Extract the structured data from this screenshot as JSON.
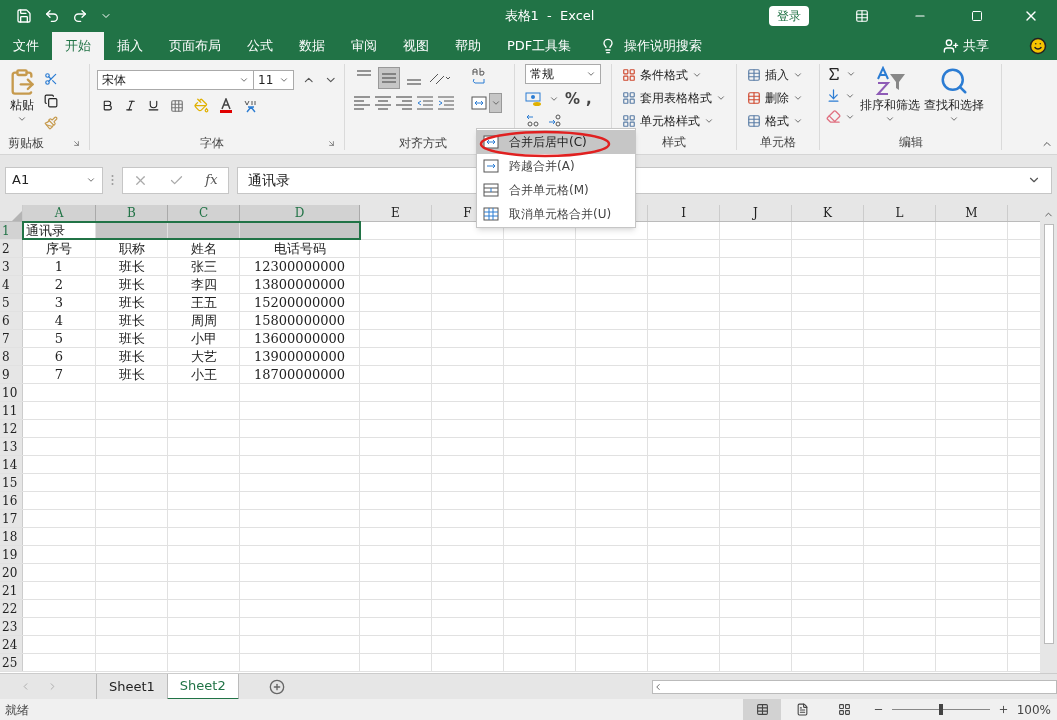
{
  "title_bar": {
    "title": "表格1  -  Excel",
    "login": "登录"
  },
  "menu_tabs": [
    {
      "label": "文件",
      "selected": false
    },
    {
      "label": "开始",
      "selected": true
    },
    {
      "label": "插入",
      "selected": false
    },
    {
      "label": "页面布局",
      "selected": false
    },
    {
      "label": "公式",
      "selected": false
    },
    {
      "label": "数据",
      "selected": false
    },
    {
      "label": "审阅",
      "selected": false
    },
    {
      "label": "视图",
      "selected": false
    },
    {
      "label": "帮助",
      "selected": false
    },
    {
      "label": "PDF工具集",
      "selected": false
    }
  ],
  "tell_me": "操作说明搜索",
  "share": "共享",
  "ribbon": {
    "clipboard": {
      "paste": "粘贴",
      "label": "剪贴板"
    },
    "font": {
      "name": "宋体",
      "size": "11",
      "label": "字体"
    },
    "alignment": {
      "vertical": [
        {
          "on": false
        },
        {
          "on": true
        },
        {
          "on": false
        }
      ],
      "label": "对齐方式"
    },
    "number": {
      "format": "常规",
      "percent": "%",
      "comma": ","
    },
    "styles": {
      "items": [
        "条件格式",
        "套用表格格式",
        "单元格样式"
      ],
      "label": "样式"
    },
    "cells": {
      "items": [
        "插入",
        "删除",
        "格式"
      ],
      "label": "单元格"
    },
    "editing": {
      "sort": "排序和筛选",
      "find": "查找和选择",
      "label": "编辑"
    }
  },
  "merge_menu": [
    {
      "label": "合并后居中(C)",
      "selected": true
    },
    {
      "label": "跨越合并(A)",
      "selected": false
    },
    {
      "label": "合并单元格(M)",
      "selected": false
    },
    {
      "label": "取消单元格合并(U)",
      "selected": false
    }
  ],
  "formula_bar": {
    "name_box": "A1",
    "function_label": "fx",
    "value": "通讯录"
  },
  "sheet": {
    "columns": [
      {
        "label": "A",
        "selected": true
      },
      {
        "label": "B",
        "selected": true
      },
      {
        "label": "C",
        "selected": true
      },
      {
        "label": "D",
        "selected": true
      },
      {
        "label": "E",
        "selected": false
      },
      {
        "label": "F",
        "selected": false
      },
      {},
      {},
      {
        "label": "I",
        "selected": false
      },
      {
        "label": "J",
        "selected": false
      },
      {
        "label": "K",
        "selected": false
      },
      {
        "label": "L",
        "selected": false
      },
      {
        "label": "M",
        "selected": false
      }
    ],
    "rows": [
      {
        "header": "1",
        "selected": true,
        "cells": [
          "通讯录"
        ]
      },
      {
        "header": "2",
        "selected": false,
        "cells": [
          "序号",
          "职称",
          "姓名",
          "电话号码"
        ]
      },
      {
        "header": "3",
        "selected": false,
        "cells": [
          "1",
          "班长",
          "张三",
          "12300000000"
        ]
      },
      {
        "header": "4",
        "selected": false,
        "cells": [
          "2",
          "班长",
          "李四",
          "13800000000"
        ]
      },
      {
        "header": "5",
        "selected": false,
        "cells": [
          "3",
          "班长",
          "王五",
          "15200000000"
        ]
      },
      {
        "header": "6",
        "selected": false,
        "cells": [
          "4",
          "班长",
          "周周",
          "15800000000"
        ]
      },
      {
        "header": "7",
        "selected": false,
        "cells": [
          "5",
          "班长",
          "小甲",
          "13600000000"
        ]
      },
      {
        "header": "8",
        "selected": false,
        "cells": [
          "6",
          "班长",
          "大艺",
          "13900000000"
        ]
      },
      {
        "header": "9",
        "selected": false,
        "cells": [
          "7",
          "班长",
          "小王",
          "18700000000"
        ]
      },
      {
        "header": "10",
        "selected": false
      },
      {
        "header": "11",
        "selected": false
      },
      {
        "header": "12",
        "selected": false
      },
      {
        "header": "13",
        "selected": false
      },
      {
        "header": "14",
        "selected": false
      },
      {
        "header": "15",
        "selected": false
      },
      {
        "header": "16",
        "selected": false
      },
      {
        "header": "17",
        "selected": false
      },
      {
        "header": "18",
        "selected": false
      },
      {
        "header": "19",
        "selected": false
      },
      {
        "header": "20",
        "selected": false
      },
      {
        "header": "21",
        "selected": false
      },
      {
        "header": "22",
        "selected": false
      },
      {
        "header": "23",
        "selected": false
      },
      {
        "header": "24",
        "selected": false
      },
      {
        "header": "25",
        "selected": false
      }
    ]
  },
  "sheet_tabs": [
    {
      "label": "Sheet1",
      "selected": false
    },
    {
      "label": "Sheet2",
      "selected": true
    }
  ],
  "status_bar": {
    "status": "就绪",
    "zoom": "100%",
    "zoom_slider": {
      "level": 0.5
    }
  }
}
